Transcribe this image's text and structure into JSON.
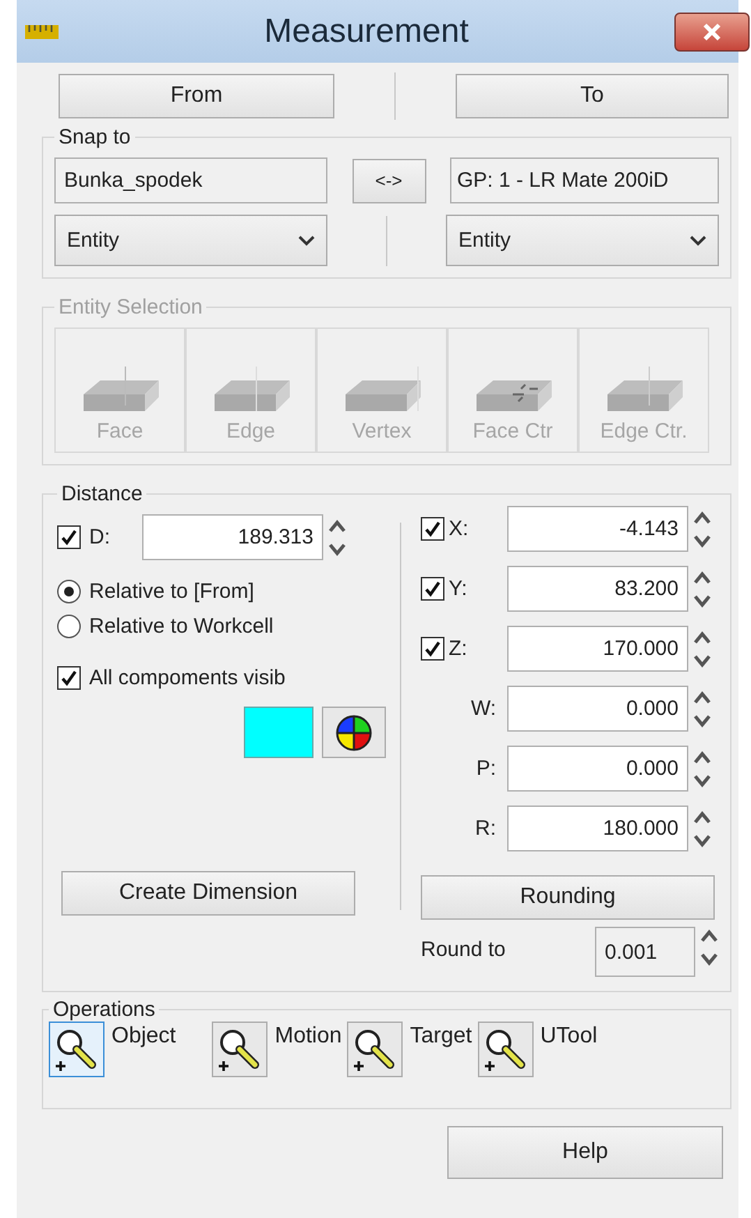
{
  "window": {
    "title": "Measurement"
  },
  "from_to": [
    {
      "label": "From"
    },
    {
      "label": "To"
    }
  ],
  "snap_to": {
    "title": "Snap to",
    "from_value": "Bunka_spodek",
    "swap_label": "<->",
    "to_value": "GP: 1 - LR Mate 200iD",
    "from_entity": "Entity",
    "to_entity": "Entity"
  },
  "entity_selection": {
    "title": "Entity Selection",
    "disabled": true,
    "buttons": [
      {
        "label": "Face",
        "kind": "face"
      },
      {
        "label": "Edge",
        "kind": "edge"
      },
      {
        "label": "Vertex",
        "kind": "vertex"
      },
      {
        "label": "Face Ctr",
        "kind": "facectr"
      },
      {
        "label": "Edge Ctr.",
        "kind": "edgectr"
      }
    ]
  },
  "distance": {
    "title": "Distance",
    "d_label": "D:",
    "d_checked": true,
    "d_value": "189.313",
    "relative": [
      {
        "label": "Relative to [From]",
        "selected": true
      },
      {
        "label": "Relative to Workcell",
        "selected": false
      }
    ],
    "all_components": {
      "label": "All compoments visib",
      "checked": true
    },
    "color": "#00ffff",
    "coords": [
      {
        "label": "X:",
        "kind": "checkbox",
        "checked": true,
        "value": "-4.143"
      },
      {
        "label": "Y:",
        "kind": "checkbox",
        "checked": true,
        "value": "83.200"
      },
      {
        "label": "Z:",
        "kind": "checkbox",
        "checked": true,
        "value": "170.000"
      },
      {
        "label": "W:",
        "kind": "plain",
        "value": "0.000"
      },
      {
        "label": "P:",
        "kind": "plain",
        "value": "0.000"
      },
      {
        "label": "R:",
        "kind": "plain",
        "value": "180.000"
      }
    ],
    "create_dimension": "Create Dimension",
    "rounding": "Rounding",
    "round_to_label": "Round to",
    "round_to_value": "0.001"
  },
  "operations": {
    "title": "Operations",
    "items": [
      {
        "label": "Object",
        "selected": true
      },
      {
        "label": "Motion",
        "selected": false
      },
      {
        "label": "Target",
        "selected": false
      },
      {
        "label": "UTool",
        "selected": false
      }
    ]
  },
  "help": "Help"
}
